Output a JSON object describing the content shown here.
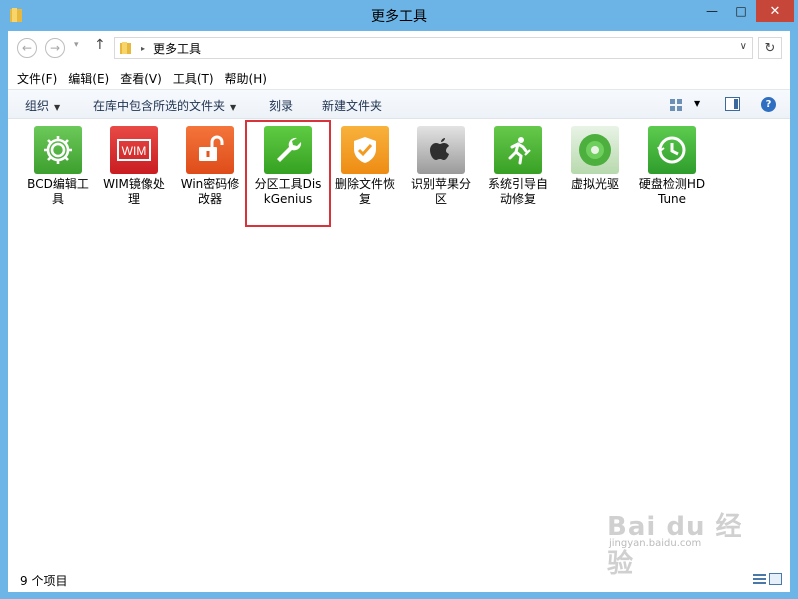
{
  "window": {
    "title": "更多工具",
    "minimize_glyph": "—",
    "maximize_glyph": "□",
    "close_glyph": "✕"
  },
  "addressbar": {
    "back_glyph": "←",
    "forward_glyph": "→",
    "history_glyph": "▾",
    "up_glyph": "↑",
    "separator_glyph": "▸",
    "path": "更多工具",
    "dropdown_glyph": "∨",
    "refresh_glyph": "↻"
  },
  "menu": [
    "文件(F)",
    "编辑(E)",
    "查看(V)",
    "工具(T)",
    "帮助(H)"
  ],
  "commandbar": {
    "organize": "组织",
    "include_in_library": "在库中包含所选的文件夹",
    "burn": "刻录",
    "new_folder": "新建文件夹",
    "dropdown_glyph": "▼",
    "help_glyph": "?"
  },
  "items": [
    {
      "label": "BCD编辑工具",
      "icon": "gear-icon",
      "color": "#4caf3e"
    },
    {
      "label": "WIM镜像处理",
      "icon": "wim-icon",
      "color": "#d8282c",
      "icon_text": "WIM"
    },
    {
      "label": "Win密码修改器",
      "icon": "unlock-icon",
      "color": "#ec5a23"
    },
    {
      "label": "分区工具DiskGenius",
      "icon": "wrench-icon",
      "color": "#43b12e"
    },
    {
      "label": "删除文件恢复",
      "icon": "shield-check-icon",
      "color": "#f39a1f"
    },
    {
      "label": "识别苹果分区",
      "icon": "apple-icon",
      "color": "#3d3d3d"
    },
    {
      "label": "系统引导自动修复",
      "icon": "running-man-icon",
      "color": "#49b02f"
    },
    {
      "label": "虚拟光驱",
      "icon": "disc-icon",
      "color": "#4caf3e"
    },
    {
      "label": "硬盘检测HDTune",
      "icon": "clock-icon",
      "color": "#39ac3a"
    }
  ],
  "selected_index": 3,
  "statusbar": {
    "text": "9 个项目"
  },
  "watermark": {
    "text": "Bai du 经验",
    "subtext": "jingyan.baidu.com"
  }
}
